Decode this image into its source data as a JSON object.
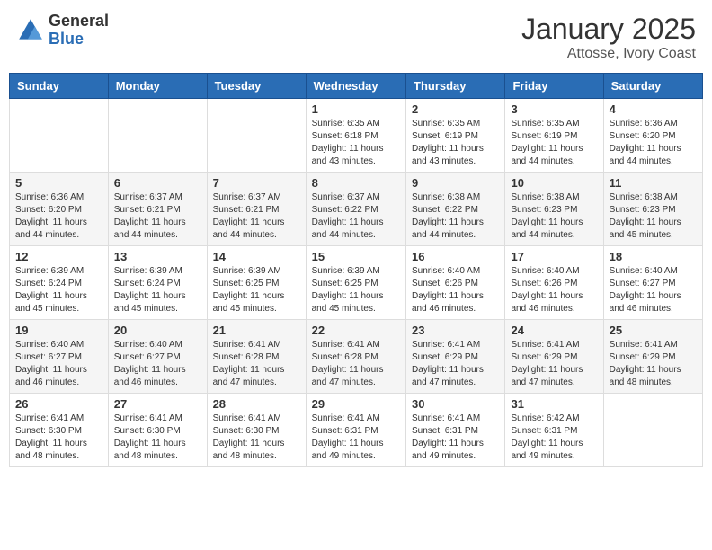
{
  "header": {
    "logo_general": "General",
    "logo_blue": "Blue",
    "month_title": "January 2025",
    "location": "Attosse, Ivory Coast"
  },
  "weekdays": [
    "Sunday",
    "Monday",
    "Tuesday",
    "Wednesday",
    "Thursday",
    "Friday",
    "Saturday"
  ],
  "weeks": [
    [
      {
        "day": "",
        "sunrise": "",
        "sunset": "",
        "daylight": ""
      },
      {
        "day": "",
        "sunrise": "",
        "sunset": "",
        "daylight": ""
      },
      {
        "day": "",
        "sunrise": "",
        "sunset": "",
        "daylight": ""
      },
      {
        "day": "1",
        "sunrise": "Sunrise: 6:35 AM",
        "sunset": "Sunset: 6:18 PM",
        "daylight": "Daylight: 11 hours and 43 minutes."
      },
      {
        "day": "2",
        "sunrise": "Sunrise: 6:35 AM",
        "sunset": "Sunset: 6:19 PM",
        "daylight": "Daylight: 11 hours and 43 minutes."
      },
      {
        "day": "3",
        "sunrise": "Sunrise: 6:35 AM",
        "sunset": "Sunset: 6:19 PM",
        "daylight": "Daylight: 11 hours and 44 minutes."
      },
      {
        "day": "4",
        "sunrise": "Sunrise: 6:36 AM",
        "sunset": "Sunset: 6:20 PM",
        "daylight": "Daylight: 11 hours and 44 minutes."
      }
    ],
    [
      {
        "day": "5",
        "sunrise": "Sunrise: 6:36 AM",
        "sunset": "Sunset: 6:20 PM",
        "daylight": "Daylight: 11 hours and 44 minutes."
      },
      {
        "day": "6",
        "sunrise": "Sunrise: 6:37 AM",
        "sunset": "Sunset: 6:21 PM",
        "daylight": "Daylight: 11 hours and 44 minutes."
      },
      {
        "day": "7",
        "sunrise": "Sunrise: 6:37 AM",
        "sunset": "Sunset: 6:21 PM",
        "daylight": "Daylight: 11 hours and 44 minutes."
      },
      {
        "day": "8",
        "sunrise": "Sunrise: 6:37 AM",
        "sunset": "Sunset: 6:22 PM",
        "daylight": "Daylight: 11 hours and 44 minutes."
      },
      {
        "day": "9",
        "sunrise": "Sunrise: 6:38 AM",
        "sunset": "Sunset: 6:22 PM",
        "daylight": "Daylight: 11 hours and 44 minutes."
      },
      {
        "day": "10",
        "sunrise": "Sunrise: 6:38 AM",
        "sunset": "Sunset: 6:23 PM",
        "daylight": "Daylight: 11 hours and 44 minutes."
      },
      {
        "day": "11",
        "sunrise": "Sunrise: 6:38 AM",
        "sunset": "Sunset: 6:23 PM",
        "daylight": "Daylight: 11 hours and 45 minutes."
      }
    ],
    [
      {
        "day": "12",
        "sunrise": "Sunrise: 6:39 AM",
        "sunset": "Sunset: 6:24 PM",
        "daylight": "Daylight: 11 hours and 45 minutes."
      },
      {
        "day": "13",
        "sunrise": "Sunrise: 6:39 AM",
        "sunset": "Sunset: 6:24 PM",
        "daylight": "Daylight: 11 hours and 45 minutes."
      },
      {
        "day": "14",
        "sunrise": "Sunrise: 6:39 AM",
        "sunset": "Sunset: 6:25 PM",
        "daylight": "Daylight: 11 hours and 45 minutes."
      },
      {
        "day": "15",
        "sunrise": "Sunrise: 6:39 AM",
        "sunset": "Sunset: 6:25 PM",
        "daylight": "Daylight: 11 hours and 45 minutes."
      },
      {
        "day": "16",
        "sunrise": "Sunrise: 6:40 AM",
        "sunset": "Sunset: 6:26 PM",
        "daylight": "Daylight: 11 hours and 46 minutes."
      },
      {
        "day": "17",
        "sunrise": "Sunrise: 6:40 AM",
        "sunset": "Sunset: 6:26 PM",
        "daylight": "Daylight: 11 hours and 46 minutes."
      },
      {
        "day": "18",
        "sunrise": "Sunrise: 6:40 AM",
        "sunset": "Sunset: 6:27 PM",
        "daylight": "Daylight: 11 hours and 46 minutes."
      }
    ],
    [
      {
        "day": "19",
        "sunrise": "Sunrise: 6:40 AM",
        "sunset": "Sunset: 6:27 PM",
        "daylight": "Daylight: 11 hours and 46 minutes."
      },
      {
        "day": "20",
        "sunrise": "Sunrise: 6:40 AM",
        "sunset": "Sunset: 6:27 PM",
        "daylight": "Daylight: 11 hours and 46 minutes."
      },
      {
        "day": "21",
        "sunrise": "Sunrise: 6:41 AM",
        "sunset": "Sunset: 6:28 PM",
        "daylight": "Daylight: 11 hours and 47 minutes."
      },
      {
        "day": "22",
        "sunrise": "Sunrise: 6:41 AM",
        "sunset": "Sunset: 6:28 PM",
        "daylight": "Daylight: 11 hours and 47 minutes."
      },
      {
        "day": "23",
        "sunrise": "Sunrise: 6:41 AM",
        "sunset": "Sunset: 6:29 PM",
        "daylight": "Daylight: 11 hours and 47 minutes."
      },
      {
        "day": "24",
        "sunrise": "Sunrise: 6:41 AM",
        "sunset": "Sunset: 6:29 PM",
        "daylight": "Daylight: 11 hours and 47 minutes."
      },
      {
        "day": "25",
        "sunrise": "Sunrise: 6:41 AM",
        "sunset": "Sunset: 6:29 PM",
        "daylight": "Daylight: 11 hours and 48 minutes."
      }
    ],
    [
      {
        "day": "26",
        "sunrise": "Sunrise: 6:41 AM",
        "sunset": "Sunset: 6:30 PM",
        "daylight": "Daylight: 11 hours and 48 minutes."
      },
      {
        "day": "27",
        "sunrise": "Sunrise: 6:41 AM",
        "sunset": "Sunset: 6:30 PM",
        "daylight": "Daylight: 11 hours and 48 minutes."
      },
      {
        "day": "28",
        "sunrise": "Sunrise: 6:41 AM",
        "sunset": "Sunset: 6:30 PM",
        "daylight": "Daylight: 11 hours and 48 minutes."
      },
      {
        "day": "29",
        "sunrise": "Sunrise: 6:41 AM",
        "sunset": "Sunset: 6:31 PM",
        "daylight": "Daylight: 11 hours and 49 minutes."
      },
      {
        "day": "30",
        "sunrise": "Sunrise: 6:41 AM",
        "sunset": "Sunset: 6:31 PM",
        "daylight": "Daylight: 11 hours and 49 minutes."
      },
      {
        "day": "31",
        "sunrise": "Sunrise: 6:42 AM",
        "sunset": "Sunset: 6:31 PM",
        "daylight": "Daylight: 11 hours and 49 minutes."
      },
      {
        "day": "",
        "sunrise": "",
        "sunset": "",
        "daylight": ""
      }
    ]
  ]
}
